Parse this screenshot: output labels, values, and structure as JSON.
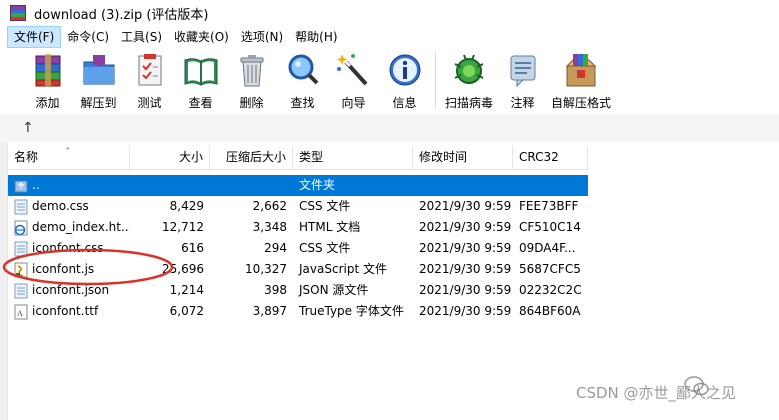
{
  "window": {
    "title": "download (3).zip (评估版本)"
  },
  "menu": [
    {
      "label": "文件(F)",
      "active": true
    },
    {
      "label": "命令(C)",
      "active": false
    },
    {
      "label": "工具(S)",
      "active": false
    },
    {
      "label": "收藏夹(O)",
      "active": false
    },
    {
      "label": "选项(N)",
      "active": false
    },
    {
      "label": "帮助(H)",
      "active": false
    }
  ],
  "toolbar": [
    {
      "label": "添加",
      "icon": "add-archive-icon"
    },
    {
      "label": "解压到",
      "icon": "extract-to-icon"
    },
    {
      "label": "测试",
      "icon": "test-icon"
    },
    {
      "label": "查看",
      "icon": "view-book-icon"
    },
    {
      "label": "删除",
      "icon": "delete-bin-icon"
    },
    {
      "label": "查找",
      "icon": "find-magnifier-icon"
    },
    {
      "label": "向导",
      "icon": "wizard-wand-icon"
    },
    {
      "label": "信息",
      "icon": "info-icon"
    },
    {
      "label": "扫描病毒",
      "icon": "virus-scan-icon"
    },
    {
      "label": "注释",
      "icon": "comment-icon"
    },
    {
      "label": "自解压格式",
      "icon": "sfx-box-icon"
    }
  ],
  "columns": {
    "name": "名称",
    "size": "大小",
    "packed": "压缩后大小",
    "type": "类型",
    "modified": "修改时间",
    "crc": "CRC32"
  },
  "files": [
    {
      "name": "..",
      "size": "",
      "packed": "",
      "type": "文件夹",
      "modified": "",
      "crc": "",
      "icon": "folder-up-icon",
      "selected": true
    },
    {
      "name": "demo.css",
      "size": "8,429",
      "packed": "2,662",
      "type": "CSS 文件",
      "modified": "2021/9/30 9:59",
      "crc": "FEE73BFF",
      "icon": "css-file-icon",
      "selected": false
    },
    {
      "name": "demo_index.ht...",
      "size": "12,712",
      "packed": "3,348",
      "type": "HTML 文档",
      "modified": "2021/9/30 9:59",
      "crc": "CF510C14",
      "icon": "html-file-icon",
      "selected": false
    },
    {
      "name": "iconfont.css",
      "size": "616",
      "packed": "294",
      "type": "CSS 文件",
      "modified": "2021/9/30 9:59",
      "crc": "09DA4F...",
      "icon": "css-file-icon",
      "selected": false
    },
    {
      "name": "iconfont.js",
      "size": "25,696",
      "packed": "10,327",
      "type": "JavaScript 文件",
      "modified": "2021/9/30 9:59",
      "crc": "5687CFC5",
      "icon": "js-file-icon",
      "selected": false
    },
    {
      "name": "iconfont.json",
      "size": "1,214",
      "packed": "398",
      "type": "JSON 源文件",
      "modified": "2021/9/30 9:59",
      "crc": "02232C2C",
      "icon": "json-file-icon",
      "selected": false
    },
    {
      "name": "iconfont.ttf",
      "size": "6,072",
      "packed": "3,897",
      "type": "TrueType 字体文件",
      "modified": "2021/9/30 9:59",
      "crc": "864BF60A",
      "icon": "ttf-file-icon",
      "selected": false
    }
  ],
  "watermark": {
    "text": "CSDN @亦世_鄙人之见"
  },
  "colors": {
    "selection": "#0078d7",
    "menu_active": "#cce8ff",
    "annotation": "#d9342b"
  }
}
